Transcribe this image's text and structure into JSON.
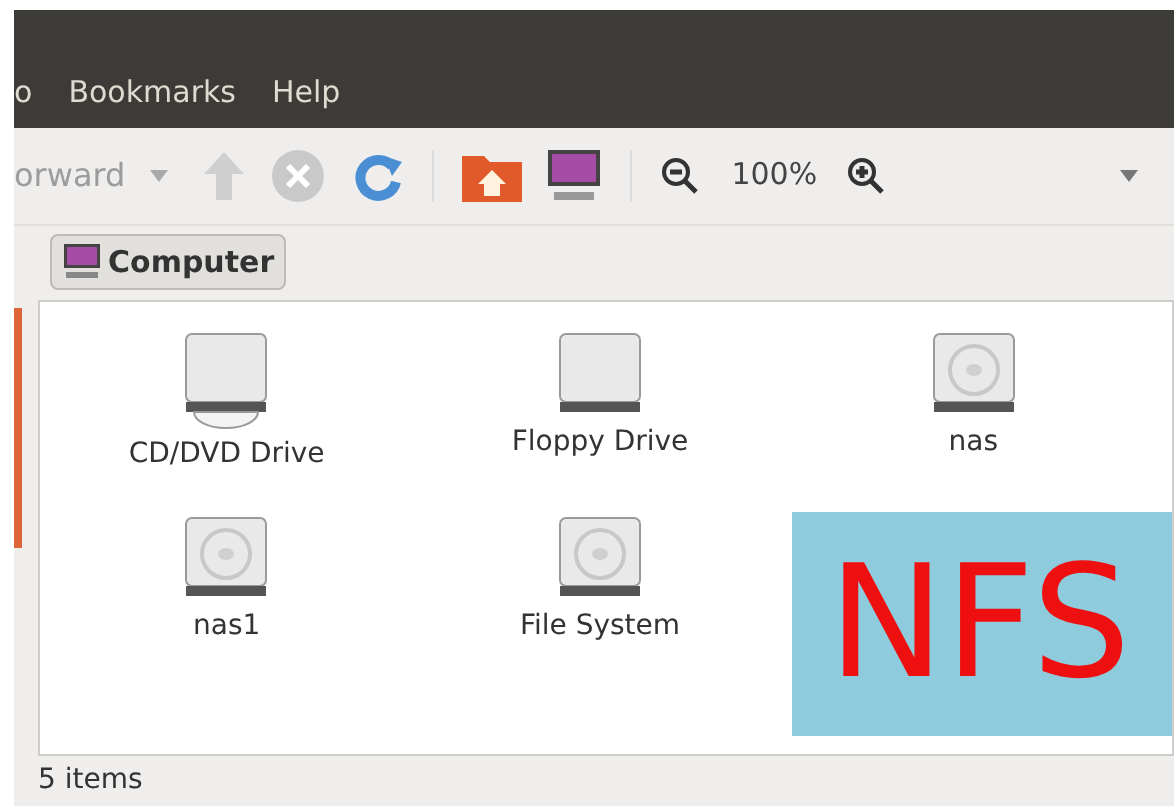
{
  "menu_bar": [
    "o",
    "Bookmarks",
    "Help"
  ],
  "toolbar": {
    "forward_label": "orward",
    "zoom": "100%"
  },
  "path_bar": [
    {
      "label": "Computer",
      "selected": true
    }
  ],
  "items": [
    {
      "name": "CD/DVD Drive",
      "kind": "optical"
    },
    {
      "name": "Floppy Drive",
      "kind": "floppy"
    },
    {
      "name": "nas",
      "kind": "disk"
    },
    {
      "name": "nas1",
      "kind": "disk"
    },
    {
      "name": "File System",
      "kind": "disk"
    }
  ],
  "overlay": {
    "label": "NFS"
  },
  "status_bar": "5 items"
}
